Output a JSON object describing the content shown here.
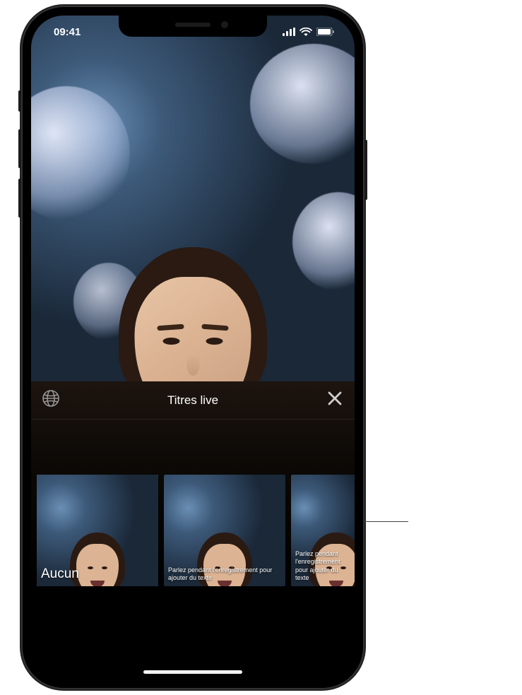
{
  "status_bar": {
    "time": "09:41"
  },
  "drawer": {
    "title": "Titres live"
  },
  "thumbs": [
    {
      "caption": "Aucun",
      "style": "none",
      "selected": true
    },
    {
      "caption": "Parlez pendant l'enregistrement pour ajouter du texte",
      "style": "small",
      "selected": false
    },
    {
      "caption": "Parlez pendant l'enregistrement pour ajouter du texte",
      "style": "small",
      "selected": false
    }
  ]
}
